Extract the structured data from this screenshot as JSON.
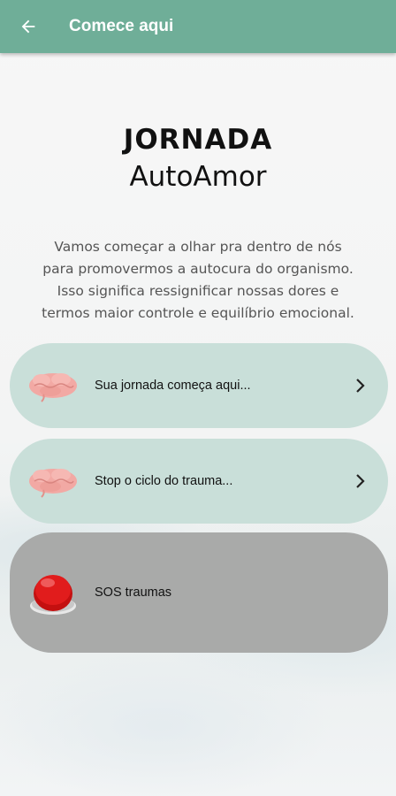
{
  "appbar": {
    "title": "Comece aqui",
    "back_icon": "arrow-left-icon",
    "color": "#6fae98"
  },
  "header": {
    "title": "JORNADA",
    "subtitle": "AutoAmor"
  },
  "description": "Vamos começar a olhar pra dentro de nós para promovermos a autocura do organismo. Isso significa ressignificar nossas dores e termos maior controle e equilíbrio emocional.",
  "cards": [
    {
      "label": "Sua jornada começa aqui...",
      "icon": "brain-icon",
      "chevron": "chevron-right-icon",
      "color": "#c9dfd9"
    },
    {
      "label": "Stop o ciclo do trauma...",
      "icon": "brain-icon",
      "chevron": "chevron-right-icon",
      "color": "#c9dfd9"
    },
    {
      "label": "SOS traumas",
      "icon": "red-button-icon",
      "color": "#a9aaa9"
    }
  ]
}
